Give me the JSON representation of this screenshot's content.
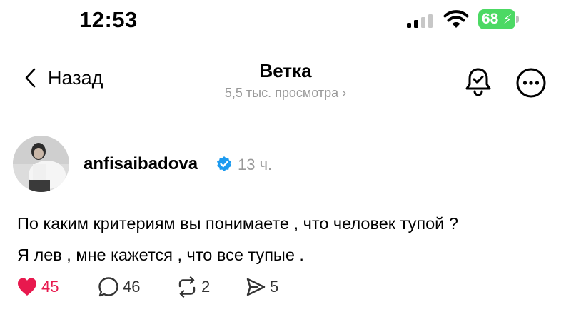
{
  "status_bar": {
    "time": "12:53",
    "battery": "68"
  },
  "nav": {
    "back_label": "Назад",
    "title": "Ветка",
    "subtitle": "5,5 тыс. просмотра ›"
  },
  "post": {
    "username": "anfisaibadova",
    "time": "13 ч.",
    "text_line1": "По каким критериям вы понимаете , что человек тупой ?",
    "text_line2": "Я лев , мне кажется , что все тупые ."
  },
  "actions": {
    "likes": "45",
    "comments": "46",
    "reposts": "2",
    "shares": "5"
  },
  "colors": {
    "like": "#e8194e",
    "verified": "#1d9bf0",
    "battery": "#4cd964",
    "muted": "#999999"
  },
  "icons": [
    "signal-icon",
    "wifi-icon",
    "battery-icon",
    "chevron-left-icon",
    "bell-check-icon",
    "more-icon",
    "verified-icon",
    "heart-icon",
    "comment-icon",
    "repost-icon",
    "share-icon"
  ]
}
